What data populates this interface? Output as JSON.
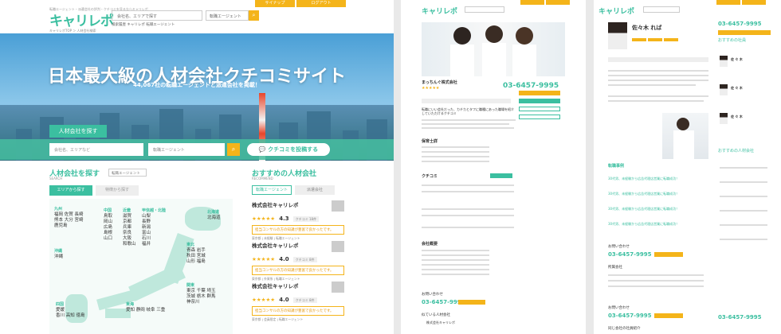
{
  "header": {
    "topline": "転職エージェント・派遣会社の評判・クチコミを見るならキャリレポ",
    "logo": "キャリレポ",
    "logo_sub": "人材会社クチコミサイト",
    "search_placeholder": "会社名、エリアで探す",
    "agent_select": "転職エージェント",
    "signup": "サイナップ",
    "login": "ログアウト",
    "keywords": "検索履歴 キャリレポ 転職エージェント",
    "breadcrumb": "キャリレポTOP ＞ 人材会社検索"
  },
  "hero": {
    "title": "日本最大級の人材会社クチコミサイト",
    "subtitle": "44,067社の転職エージェントと派遣会社を掲載！",
    "tab": "人材会社を探す",
    "input_placeholder": "会社名、エリアなど",
    "select_placeholder": "転職エージェント",
    "post_button": "クチコミを投稿する"
  },
  "search_section": {
    "title": "人材会社を探す",
    "sub": "SEARCH",
    "select": "転職エージェント",
    "tab_area": "エリアから探す",
    "tab_feature": "特徴から探す",
    "regions": [
      {
        "name": "九州",
        "prefs": "福岡 佐賀 長崎\n熊本 大分 宮崎\n鹿児島"
      },
      {
        "name": "中国",
        "prefs": "鳥取\n岡山\n広島\n島根\n山口"
      },
      {
        "name": "近畿",
        "prefs": "滋賀\n京都\n兵庫\n奈良\n大阪\n和歌山"
      },
      {
        "name": "甲信越・北陸",
        "prefs": "山梨\n長野\n新潟\n富山\n石川\n福井"
      },
      {
        "name": "北海道",
        "prefs": "北海道"
      },
      {
        "name": "東北",
        "prefs": "青森 岩手\n秋田 宮城\n山形 福島"
      },
      {
        "name": "関東",
        "prefs": "東京 千葉 埼玉\n茨城 栃木 群馬\n神奈川"
      },
      {
        "name": "沖縄",
        "prefs": "沖縄"
      },
      {
        "name": "四国",
        "prefs": "愛媛\n香川 高知 徳島"
      },
      {
        "name": "東海",
        "prefs": "愛知 静岡 岐阜 三重"
      }
    ]
  },
  "recommend": {
    "title": "おすすめの人材会社",
    "sub": "RECOMMEND",
    "tab_agent": "転職エージェント",
    "tab_dispatch": "派遣会社",
    "cards": [
      {
        "name": "株式会社キャリレポ",
        "stars": "★★★★★",
        "score": "4.3",
        "count": "クチコミ 18件",
        "tag": "担当コンサルの方の知識が豊富で良かったです。",
        "foot": "東京都 | 未経験 | 転職エージェント"
      },
      {
        "name": "株式会社キャリレポ",
        "stars": "★★★★★",
        "score": "4.0",
        "count": "クチコミ 8件",
        "tag": "担当コンサルの方の知識が豊富で良かったです。",
        "foot": "東京都 | 外資系 | 転職エージェント"
      },
      {
        "name": "株式会社キャリレポ",
        "stars": "★★★★★",
        "score": "4.0",
        "count": "クチコミ 8件",
        "tag": "担当コンサルの方の知識が豊富で良かったです。",
        "foot": "東京都 | 会員限定 | 転職エージェント"
      }
    ]
  },
  "middle": {
    "logo": "キャリレポ",
    "company": "まっちんぐ株式会社",
    "phone": "03-6457-9995",
    "heading": "転職にいい会社だった、カチカとタフに職種にあった職場を紹介していただけるクチコミ",
    "sec_basic": "保育士詳",
    "sec_review": "クチコミ",
    "sec_overview": "会社概要",
    "sec_contact": "お問い合わせ",
    "phone2": "03-6457-9995",
    "sec_similar": "似ている人材会社",
    "company2": "株式会社キャリレポ"
  },
  "right_page": {
    "logo": "キャリレポ",
    "person": "佐々木 れば",
    "phone": "03-6457-9995",
    "rec": "おすすめの社員",
    "rec_names": [
      "佐 々 木",
      "佐 々 木",
      "佐 々 木"
    ],
    "rec_companies": "おすすめの人材会社",
    "cases": "転職事例",
    "case_title": "30代男、未経験から広告代理店営業に転職成功！",
    "contact": "お問い合わせ",
    "phone2": "03-6457-9995",
    "company_sec": "所属会社",
    "contact2": "お問い合わせ",
    "phone3": "03-6457-9995",
    "similar": "同じ会社の社員紹介"
  },
  "colors": {
    "accent": "#3bbfa0",
    "yellow": "#f4b41a"
  }
}
